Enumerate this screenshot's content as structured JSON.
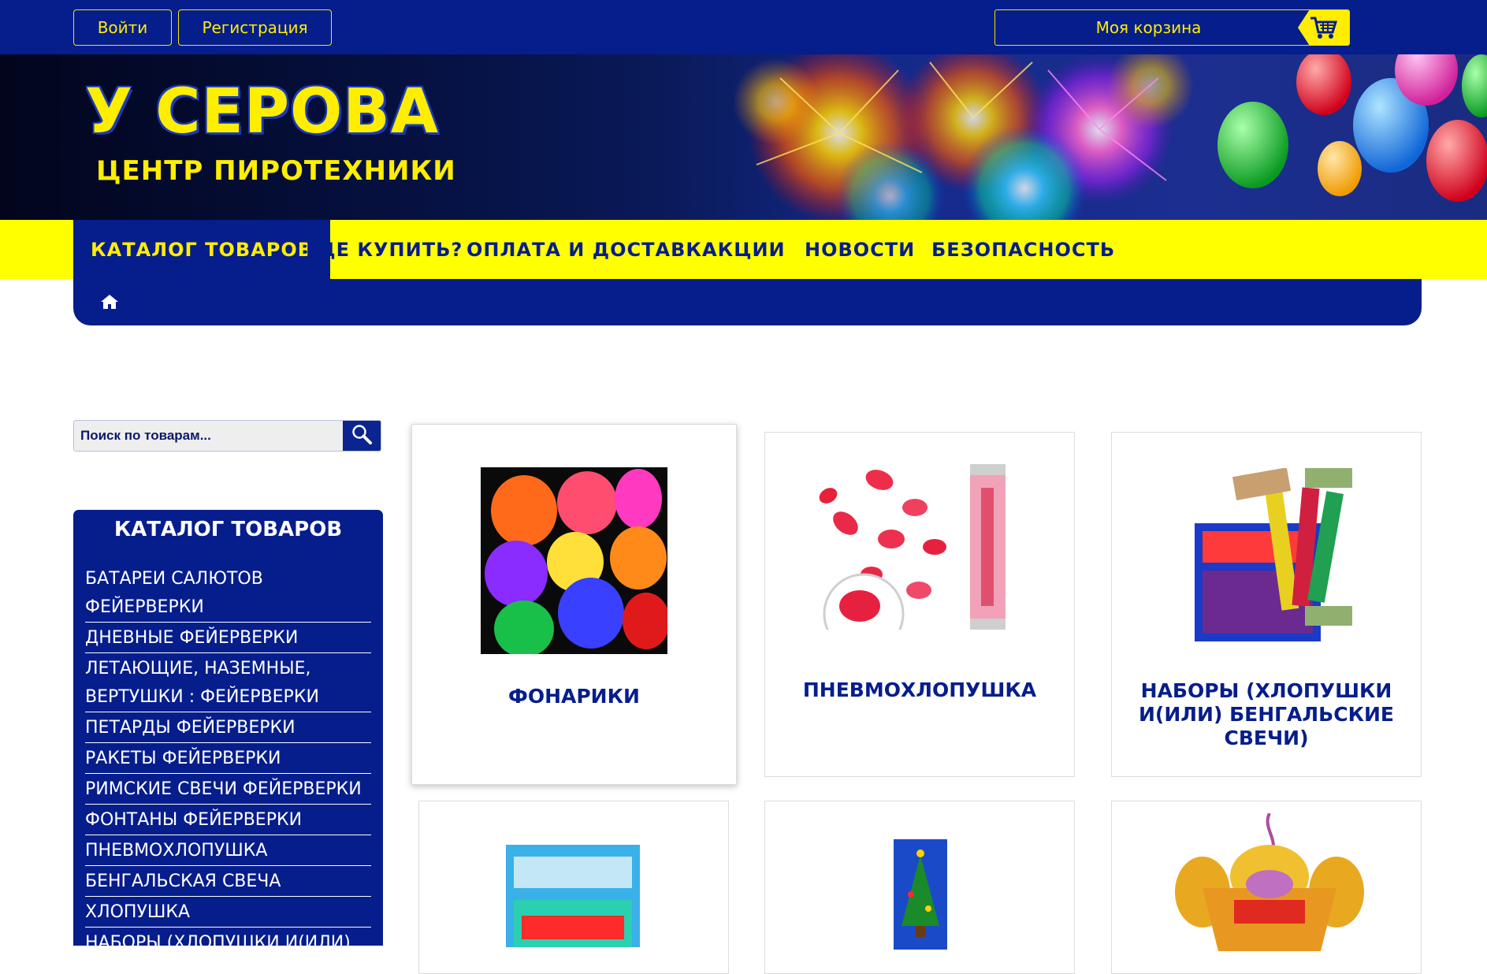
{
  "header": {
    "login_label": "Войти",
    "register_label": "Регистрация",
    "cart_label": "Моя корзина",
    "cart_icon": "shopping-cart-icon"
  },
  "logo": {
    "main": "У СЕРОВА",
    "sub": "ЦЕНТР ПИРОТЕХНИКИ"
  },
  "nav": {
    "items": [
      {
        "label": "КАТАЛОГ ТОВАРОВ",
        "active": true
      },
      {
        "label": "ГДЕ КУПИТЬ?"
      },
      {
        "label": "ОПЛАТА И ДОСТАВКА"
      },
      {
        "label": "АКЦИИ"
      },
      {
        "label": "НОВОСТИ"
      },
      {
        "label": "БЕЗОПАСНОСТЬ"
      }
    ]
  },
  "breadcrumb": {
    "home_icon": "home-icon"
  },
  "search": {
    "placeholder": "Поиск по товарам...",
    "icon": "search-icon"
  },
  "catalog": {
    "title": "КАТАЛОГ ТОВАРОВ",
    "items": [
      "БАТАРЕИ САЛЮТОВ ФЕЙЕРВЕРКИ",
      "ДНЕВНЫЕ ФЕЙЕРВЕРКИ",
      "ЛЕТАЮЩИЕ, НАЗЕМНЫЕ, ВЕРТУШКИ : ФЕЙЕРВЕРКИ",
      "ПЕТАРДЫ ФЕЙЕРВЕРКИ",
      "РАКЕТЫ ФЕЙЕРВЕРКИ",
      "РИМСКИЕ СВЕЧИ ФЕЙЕРВЕРКИ",
      "ФОНТАНЫ ФЕЙЕРВЕРКИ",
      "ПНЕВМОХЛОПУШКА",
      "БЕНГАЛЬСКАЯ СВЕЧА",
      "ХЛОПУШКА",
      "НАБОРЫ (ХЛОПУШКИ И(ИЛИ)"
    ]
  },
  "products": [
    {
      "title": "ФОНАРИКИ"
    },
    {
      "title": "ПНЕВМОХЛОПУШКА"
    },
    {
      "title": "НАБОРЫ (ХЛОПУШКИ И(ИЛИ) БЕНГАЛЬСКИЕ СВЕЧИ)"
    },
    {
      "title": ""
    },
    {
      "title": ""
    },
    {
      "title": ""
    }
  ],
  "colors": {
    "brand_blue": "#061d8c",
    "brand_yellow": "#ffee00"
  }
}
